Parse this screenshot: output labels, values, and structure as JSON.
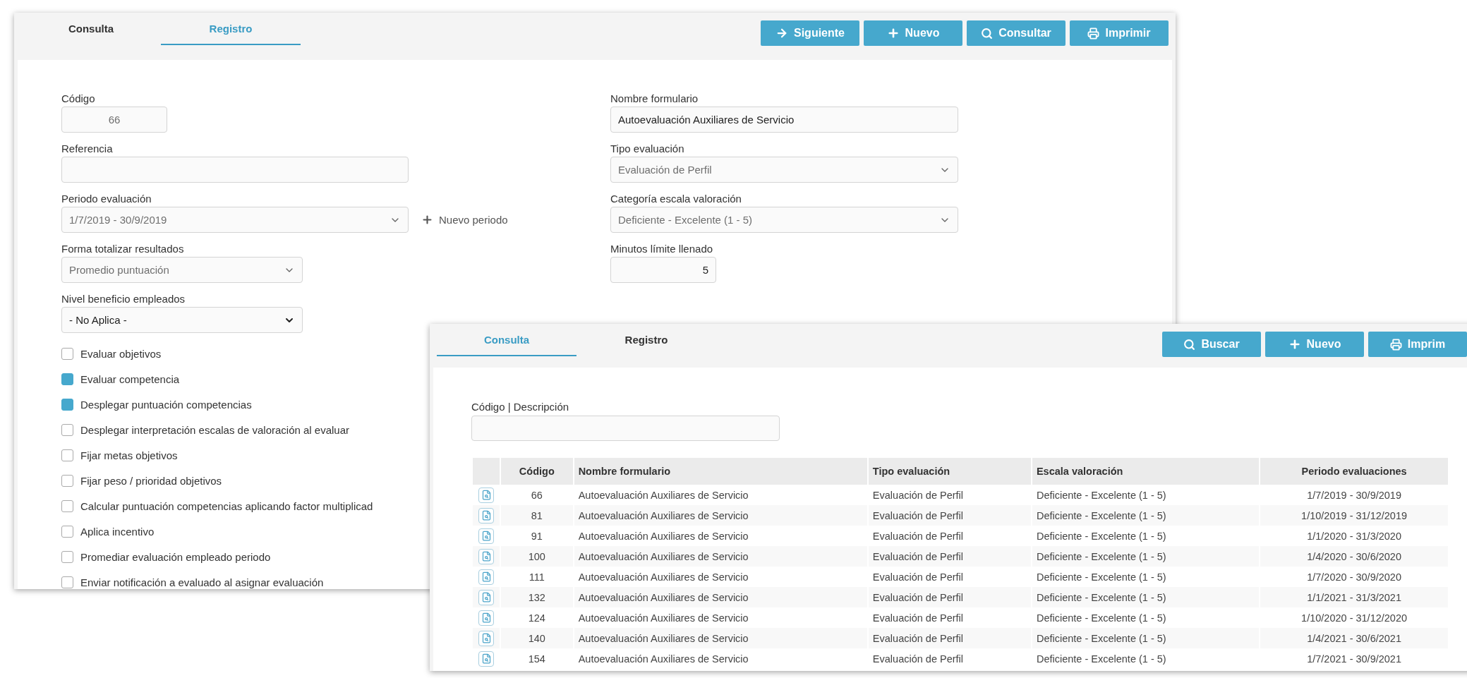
{
  "registro_window": {
    "tabs": [
      {
        "label": "Consulta",
        "selected": false
      },
      {
        "label": "Registro",
        "selected": true
      }
    ],
    "buttons": [
      {
        "kind": "next",
        "label": "Siguiente"
      },
      {
        "kind": "new",
        "label": "Nuevo"
      },
      {
        "kind": "search",
        "label": "Consultar"
      },
      {
        "kind": "print",
        "label": "Imprimir"
      }
    ],
    "left_fields": [
      {
        "kind": "code",
        "label": "Código",
        "value": "66",
        "disabled": true
      },
      {
        "kind": "text",
        "label": "Referencia"
      },
      {
        "kind": "select",
        "label": "Periodo evaluación",
        "value": "1/7/2019 - 30/9/2019",
        "disabled": true,
        "action": "Nuevo periodo"
      },
      {
        "kind": "select",
        "label": "Forma totalizar resultados",
        "value": "Promedio puntuación",
        "disabled": true
      },
      {
        "kind": "select",
        "label": "Nivel beneficio empleados",
        "value": "- No Aplica -",
        "disabled": false
      }
    ],
    "right_fields": [
      {
        "kind": "text",
        "label": "Nombre formulario",
        "value": "Autoevaluación Auxiliares de Servicio",
        "disabled": false
      },
      {
        "kind": "select",
        "label": "Tipo evaluación",
        "value": "Evaluación de Perfil",
        "disabled": true
      },
      {
        "kind": "select",
        "label": "Categoría escala valoración",
        "value": "Deficiente - Excelente (1 - 5)",
        "disabled": true
      },
      {
        "kind": "number",
        "label": "Minutos límite llenado",
        "value": "5",
        "disabled": false
      }
    ],
    "checkboxes": [
      {
        "label": "Evaluar objetivos",
        "checked": false
      },
      {
        "label": "Evaluar competencia",
        "checked": true
      },
      {
        "label": "Desplegar puntuación competencias",
        "checked": true
      },
      {
        "label": "Desplegar interpretación escalas de valoración al evaluar",
        "checked": false
      },
      {
        "label": "Fijar metas objetivos",
        "checked": false
      },
      {
        "label": "Fijar peso / prioridad objetivos",
        "checked": false
      },
      {
        "label": "Calcular puntuación competencias aplicando factor multiplicad",
        "checked": false
      },
      {
        "label": "Aplica incentivo",
        "checked": false
      },
      {
        "label": "Promediar evaluación empleado periodo",
        "checked": false
      },
      {
        "label": "Enviar notificación a evaluado al asignar evaluación",
        "checked": false
      }
    ]
  },
  "consulta_window": {
    "tabs": [
      {
        "label": "Consulta",
        "selected": true
      },
      {
        "label": "Registro",
        "selected": false
      }
    ],
    "buttons": [
      {
        "kind": "search",
        "label": "Buscar"
      },
      {
        "kind": "new",
        "label": "Nuevo"
      },
      {
        "kind": "print",
        "label": "Imprim"
      }
    ],
    "search": {
      "label": "Código | Descripción"
    },
    "table": {
      "columns": [
        "Código",
        "Nombre formulario",
        "Tipo evaluación",
        "Escala valoración",
        "Periodo evaluaciones"
      ],
      "rows": [
        [
          "66",
          "Autoevaluación Auxiliares de Servicio",
          "Evaluación de Perfil",
          "Deficiente - Excelente (1 - 5)",
          "1/7/2019 - 30/9/2019"
        ],
        [
          "81",
          "Autoevaluación Auxiliares de Servicio",
          "Evaluación de Perfil",
          "Deficiente - Excelente (1 - 5)",
          "1/10/2019 - 31/12/2019"
        ],
        [
          "91",
          "Autoevaluación Auxiliares de Servicio",
          "Evaluación de Perfil",
          "Deficiente - Excelente (1 - 5)",
          "1/1/2020 - 31/3/2020"
        ],
        [
          "100",
          "Autoevaluación Auxiliares de Servicio",
          "Evaluación de Perfil",
          "Deficiente - Excelente (1 - 5)",
          "1/4/2020 - 30/6/2020"
        ],
        [
          "111",
          "Autoevaluación Auxiliares de Servicio",
          "Evaluación de Perfil",
          "Deficiente - Excelente (1 - 5)",
          "1/7/2020 - 30/9/2020"
        ],
        [
          "132",
          "Autoevaluación Auxiliares de Servicio",
          "Evaluación de Perfil",
          "Deficiente - Excelente (1 - 5)",
          "1/1/2021 - 31/3/2021"
        ],
        [
          "124",
          "Autoevaluación Auxiliares de Servicio",
          "Evaluación de Perfil",
          "Deficiente - Excelente (1 - 5)",
          "1/10/2020 - 31/12/2020"
        ],
        [
          "140",
          "Autoevaluación Auxiliares de Servicio",
          "Evaluación de Perfil",
          "Deficiente - Excelente (1 - 5)",
          "1/4/2021 - 30/6/2021"
        ],
        [
          "154",
          "Autoevaluación Auxiliares de Servicio",
          "Evaluación de Perfil",
          "Deficiente - Excelente (1 - 5)",
          "1/7/2021 - 30/9/2021"
        ]
      ]
    }
  }
}
